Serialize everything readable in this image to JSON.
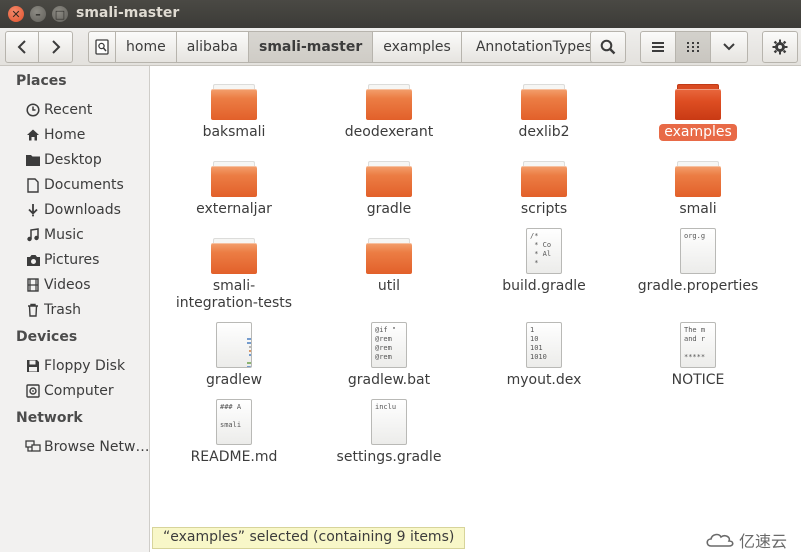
{
  "window": {
    "title": "smali-master"
  },
  "breadcrumb": [
    "home",
    "alibaba",
    "smali-master",
    "examples",
    "AnnotationTypes"
  ],
  "sidebar": {
    "places_header": "Places",
    "places": [
      {
        "label": "Recent",
        "icon": "clock-icon"
      },
      {
        "label": "Home",
        "icon": "home-icon"
      },
      {
        "label": "Desktop",
        "icon": "desktop-icon"
      },
      {
        "label": "Documents",
        "icon": "document-icon"
      },
      {
        "label": "Downloads",
        "icon": "download-icon"
      },
      {
        "label": "Music",
        "icon": "music-icon"
      },
      {
        "label": "Pictures",
        "icon": "camera-icon"
      },
      {
        "label": "Videos",
        "icon": "film-icon"
      },
      {
        "label": "Trash",
        "icon": "trash-icon"
      }
    ],
    "devices_header": "Devices",
    "devices": [
      {
        "label": "Floppy Disk",
        "icon": "floppy-icon"
      },
      {
        "label": "Computer",
        "icon": "computer-icon"
      }
    ],
    "network_header": "Network",
    "network": [
      {
        "label": "Browse Netw…",
        "icon": "network-icon"
      }
    ]
  },
  "files": [
    {
      "name": "baksmali",
      "type": "folder"
    },
    {
      "name": "deodexerant",
      "type": "folder"
    },
    {
      "name": "dexlib2",
      "type": "folder"
    },
    {
      "name": "examples",
      "type": "folder",
      "selected": true
    },
    {
      "name": "externaljar",
      "type": "folder"
    },
    {
      "name": "gradle",
      "type": "folder"
    },
    {
      "name": "scripts",
      "type": "folder"
    },
    {
      "name": "smali",
      "type": "folder"
    },
    {
      "name": "smali-integration-tests",
      "type": "folder"
    },
    {
      "name": "util",
      "type": "folder"
    },
    {
      "name": "build.gradle",
      "type": "file",
      "preview": "/*\n * Co\n * Al\n *"
    },
    {
      "name": "gradle.properties",
      "type": "file",
      "preview": "org.g"
    },
    {
      "name": "gradlew",
      "type": "script"
    },
    {
      "name": "gradlew.bat",
      "type": "file",
      "preview": "@if \"\n@rem\n@rem\n@rem"
    },
    {
      "name": "myout.dex",
      "type": "file",
      "preview": "1\n10\n101\n1010"
    },
    {
      "name": "NOTICE",
      "type": "file",
      "preview": "The m\nand r\n\n*****"
    },
    {
      "name": "README.md",
      "type": "file",
      "preview": "### A\n\nsmali"
    },
    {
      "name": "settings.gradle",
      "type": "file",
      "preview": "inclu"
    }
  ],
  "status": {
    "text": "“examples” selected (containing 9 items)"
  },
  "watermark": {
    "text": "亿速云"
  },
  "colors": {
    "accent": "#e86a47",
    "folder": "#e9713a",
    "titlebar": "#3c3b37"
  }
}
